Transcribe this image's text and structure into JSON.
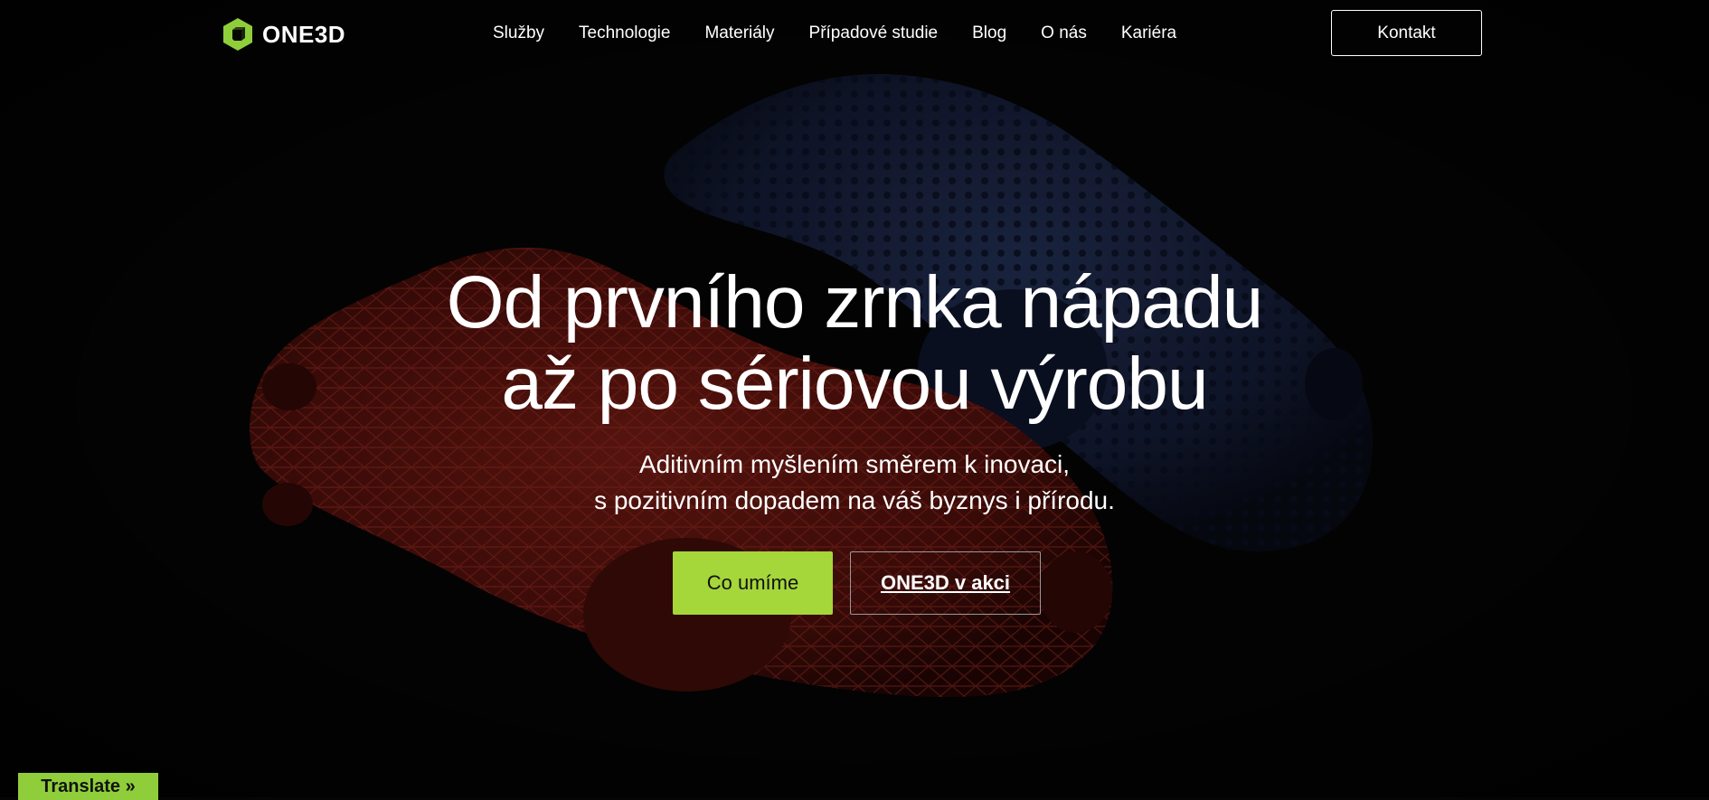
{
  "header": {
    "logo_text": "ONE3D",
    "nav": [
      {
        "label": "Služby"
      },
      {
        "label": "Technologie"
      },
      {
        "label": "Materiály"
      },
      {
        "label": "Případové studie"
      },
      {
        "label": "Blog"
      },
      {
        "label": "O nás"
      },
      {
        "label": "Kariéra"
      }
    ],
    "contact_label": "Kontakt"
  },
  "hero": {
    "title_line1": "Od prvního zrnka nápadu",
    "title_line2": "až po sériovou výrobu",
    "subtitle_line1": "Aditivním myšlením směrem k inovaci,",
    "subtitle_line2": "s pozitivním dopadem na váš byznys i přírodu.",
    "primary_button": "Co umíme",
    "secondary_button": "ONE3D v akci"
  },
  "translate": {
    "label": "Translate »"
  },
  "colors": {
    "accent": "#a5d63a",
    "background": "#050505",
    "red_part": "#7a1a14",
    "blue_part": "#1f2c52"
  },
  "images": {
    "hero_background": "red and blue 3d-printed lattice parts on black"
  }
}
